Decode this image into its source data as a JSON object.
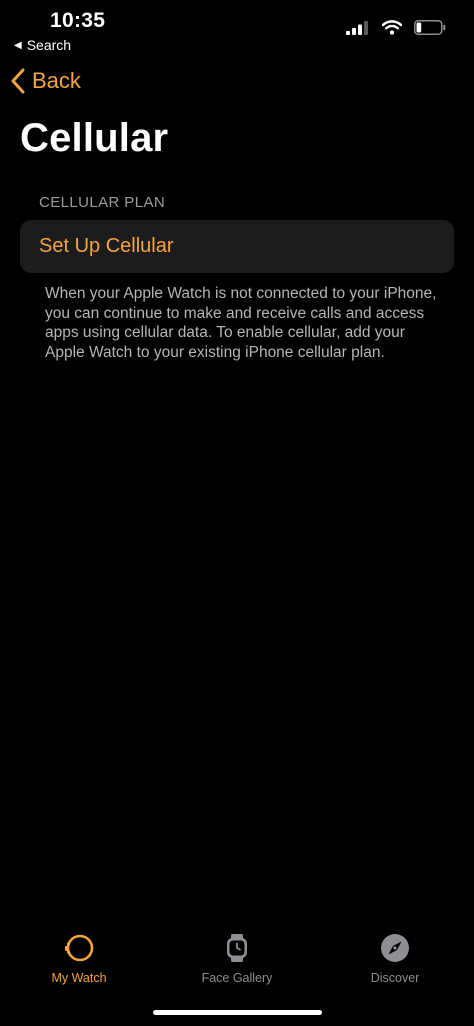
{
  "status_bar": {
    "time": "10:35",
    "back_app_label": "Search",
    "battery_level": 0.2
  },
  "nav": {
    "back_label": "Back"
  },
  "page": {
    "title": "Cellular"
  },
  "section": {
    "header": "CELLULAR PLAN",
    "cell_label": "Set Up Cellular",
    "footer": "When your Apple Watch is not connected to your iPhone, you can continue to make and receive calls and access apps using cellular data. To enable cellular, add your Apple Watch to your existing iPhone cellular plan."
  },
  "tab_bar": {
    "tabs": [
      {
        "label": "My Watch",
        "icon": "watch-icon",
        "active": true
      },
      {
        "label": "Face Gallery",
        "icon": "face-gallery-icon",
        "active": false
      },
      {
        "label": "Discover",
        "icon": "compass-icon",
        "active": false
      }
    ]
  },
  "colors": {
    "accent": "#f4a540",
    "background": "#000000",
    "cell_background": "#1c1c1e",
    "secondary_text": "#8e8e93"
  }
}
